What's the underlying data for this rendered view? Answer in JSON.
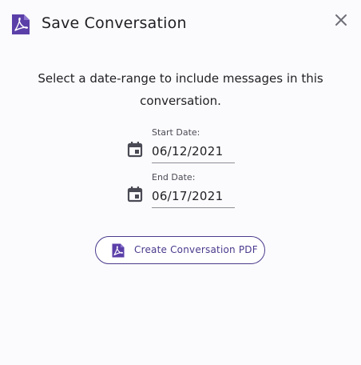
{
  "dialog": {
    "title": "Save Conversation",
    "close_icon": "close-icon",
    "header_icon": "pdf-document-icon"
  },
  "instruction": {
    "line1": "Select a date-range to include messages in this",
    "line2": "conversation."
  },
  "start_date": {
    "label": "Start Date:",
    "value": "06/12/2021",
    "icon": "calendar-icon"
  },
  "end_date": {
    "label": "End Date:",
    "value": "06/17/2021",
    "icon": "calendar-icon"
  },
  "create_button": {
    "label": "Create Conversation PDF",
    "icon": "pdf-document-icon"
  },
  "colors": {
    "accent": "#4b3a8c",
    "icon_purple": "#5b3fa8",
    "icon_gray": "#4a4a55"
  }
}
